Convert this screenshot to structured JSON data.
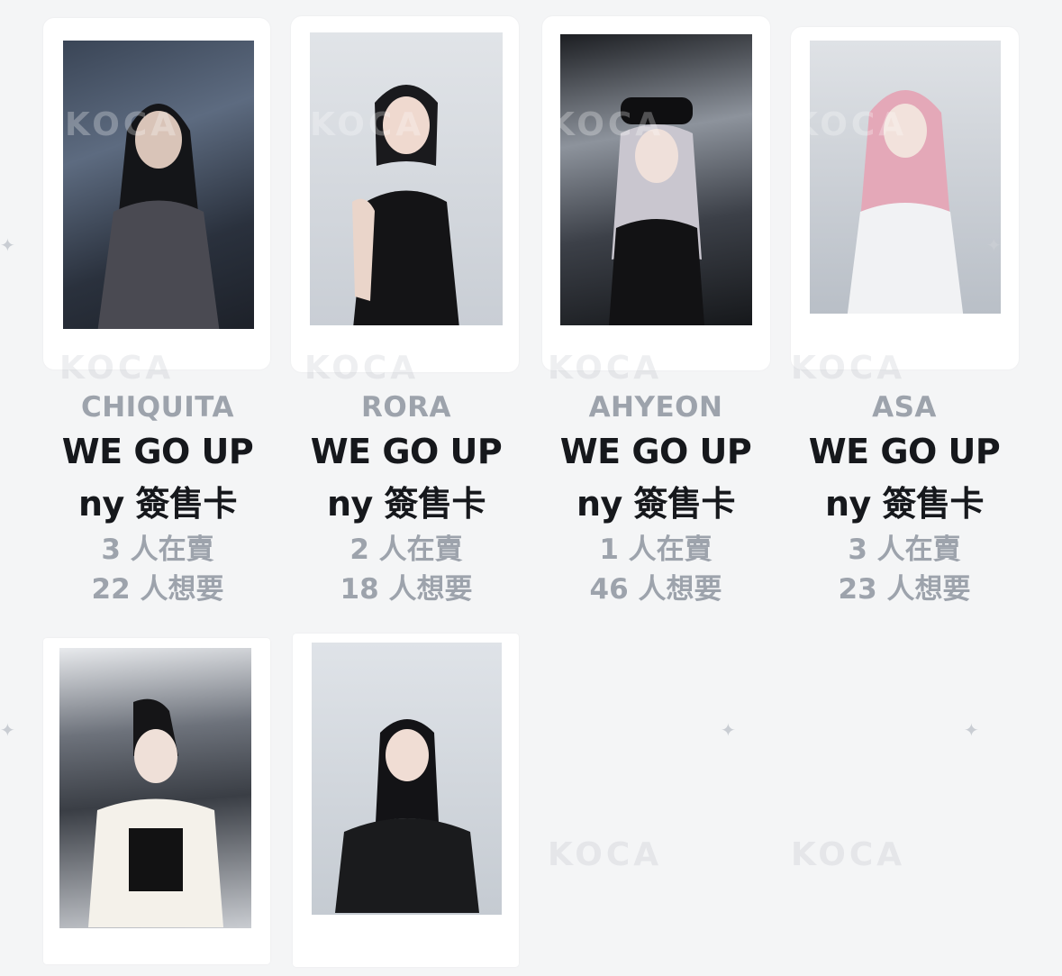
{
  "watermark": "KOCA",
  "cards": [
    {
      "name": "CHIQUITA",
      "title_line1": "WE GO UP",
      "title_line2": "ny 簽售卡",
      "selling": "3 人在賣",
      "wanting": "22 人想要"
    },
    {
      "name": "RORA",
      "title_line1": "WE GO UP",
      "title_line2": "ny 簽售卡",
      "selling": "2 人在賣",
      "wanting": "18 人想要"
    },
    {
      "name": "AHYEON",
      "title_line1": "WE GO UP",
      "title_line2": "ny 簽售卡",
      "selling": "1 人在賣",
      "wanting": "46 人想要"
    },
    {
      "name": "ASA",
      "title_line1": "WE GO UP",
      "title_line2": "ny 簽售卡",
      "selling": "3 人在賣",
      "wanting": "23 人想要"
    }
  ],
  "colors": {
    "background": "#f4f5f6",
    "card": "#ffffff",
    "title": "#16181c",
    "muted": "#9da3ac"
  }
}
